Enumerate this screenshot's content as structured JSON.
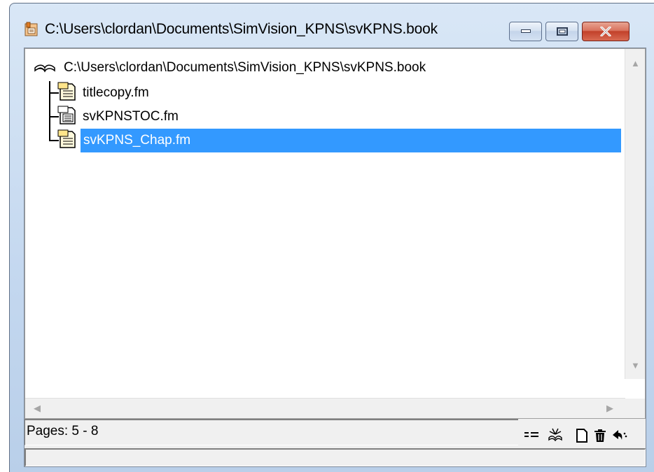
{
  "window": {
    "title": "C:\\Users\\clordan\\Documents\\SimVision_KPNS\\svKPNS.book"
  },
  "tree": {
    "root_label": "C:\\Users\\clordan\\Documents\\SimVision_KPNS\\svKPNS.book",
    "root_icon": "book-icon",
    "items": [
      {
        "label": "titlecopy.fm",
        "icon": "document-icon",
        "selected": false
      },
      {
        "label": "svKPNSTOC.fm",
        "icon": "toc-document-icon",
        "selected": false
      },
      {
        "label": "svKPNS_Chap.fm",
        "icon": "document-icon",
        "selected": true
      }
    ]
  },
  "status": {
    "pages": "Pages: 5 - 8"
  },
  "toolbar": {
    "icons": [
      "list-view-icon",
      "update-book-icon",
      "new-document-icon",
      "delete-icon",
      "undo-icon"
    ]
  },
  "colors": {
    "selection": "#3399ff",
    "close_button": "#c2412a"
  }
}
